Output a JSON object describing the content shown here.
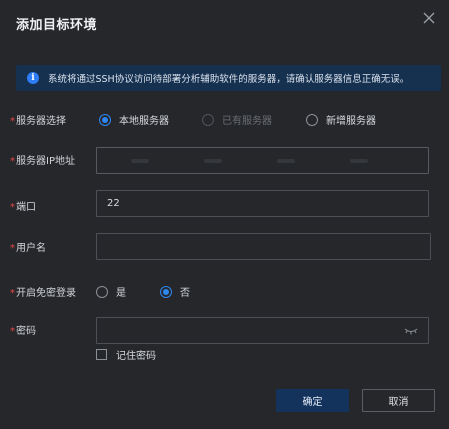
{
  "dialog": {
    "title": "添加目标环境",
    "info_text": "系统将通过SSH协议访问待部署分析辅助软件的服务器，请确认服务器信息正确无误。"
  },
  "server_select": {
    "label": "服务器选择",
    "options": [
      {
        "label": "本地服务器",
        "checked": true,
        "disabled": false
      },
      {
        "label": "已有服务器",
        "checked": false,
        "disabled": true
      },
      {
        "label": "新增服务器",
        "checked": false,
        "disabled": false
      }
    ]
  },
  "server_ip": {
    "label": "服务器IP地址",
    "value": ""
  },
  "port": {
    "label": "端口",
    "value": "22"
  },
  "username": {
    "label": "用户名",
    "value": ""
  },
  "passwordless": {
    "label": "开启免密登录",
    "options": [
      {
        "label": "是",
        "checked": false
      },
      {
        "label": "否",
        "checked": true
      }
    ]
  },
  "password": {
    "label": "密码",
    "value": "",
    "remember_label": "记住密码",
    "remember_checked": false
  },
  "buttons": {
    "confirm": "确定",
    "cancel": "取消"
  },
  "colors": {
    "accent": "#2e86f0",
    "required": "#e7484b",
    "info_bg": "#16304f",
    "primary_btn": "#14335c"
  },
  "icons": [
    "close-icon",
    "info-icon",
    "eye-closed-icon"
  ]
}
